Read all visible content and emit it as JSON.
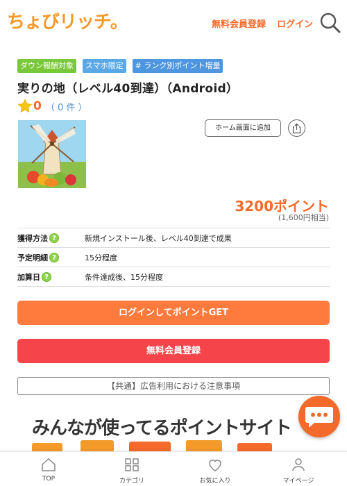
{
  "header": {
    "logo_text": "ちょびリッチ。",
    "signup_label": "無料会員登録",
    "login_label": "ログイン",
    "search_icon": "search-icon"
  },
  "tags": [
    {
      "label": "ダウン報酬対象",
      "color": "#79c83a"
    },
    {
      "label": "スマホ限定",
      "color": "#5aa8e6"
    },
    {
      "label": "# ランク別ポイント増量",
      "color": "#4f96e0"
    }
  ],
  "offer": {
    "title": "実りの地（レベル40到達）（Android）",
    "rating_score": "0",
    "rating_count": "（ 0 件 ）",
    "home_button_label": "ホーム画面に追加",
    "points": "3200ポイント",
    "yen_equivalent": "(1,600円相当)"
  },
  "info": [
    {
      "label": "獲得方法",
      "value": "新規インストール後、レベル40到達で成果"
    },
    {
      "label": "予定明細",
      "value": "15分程度"
    },
    {
      "label": "加算日",
      "value": "条件達成後、15分程度"
    }
  ],
  "buttons": {
    "login_get": "ログインしてポイントGET",
    "signup": "無料会員登録",
    "notice": "【共通】広告利用における注意事項"
  },
  "banner": {
    "text": "みんなが使ってるポイントサイト"
  },
  "bottom_nav": [
    {
      "label": "TOP",
      "icon": "home-icon"
    },
    {
      "label": "カテゴリ",
      "icon": "category-icon"
    },
    {
      "label": "お気に入り",
      "icon": "heart-icon"
    },
    {
      "label": "マイページ",
      "icon": "user-icon"
    }
  ],
  "colors": {
    "accent": "#f36a2a",
    "login_button": "#ff7b3d",
    "signup_button": "#f5454a"
  }
}
